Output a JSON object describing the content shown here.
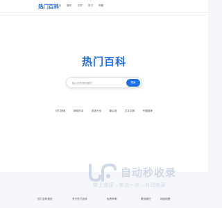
{
  "header": {
    "logo": "热门百科",
    "nav": [
      "热点",
      "娱乐",
      "文学",
      "学习",
      "专题"
    ]
  },
  "hero": {
    "title": "热门百科"
  },
  "search": {
    "placeholder": "输入你的想知道的",
    "button": "搜索"
  },
  "quick_links": [
    "热门搜索",
    "网络热词",
    "成语大全",
    "歇后语",
    "汉字字典",
    "专题推荐"
  ],
  "watermark": {
    "title": "自动秒收录",
    "subtitle": "做上链接→来访一次→自动收录"
  },
  "footer": {
    "links": [
      "热门百科首页",
      "关于热门百科",
      "免责声明",
      "联系我们",
      "网站地图"
    ]
  }
}
